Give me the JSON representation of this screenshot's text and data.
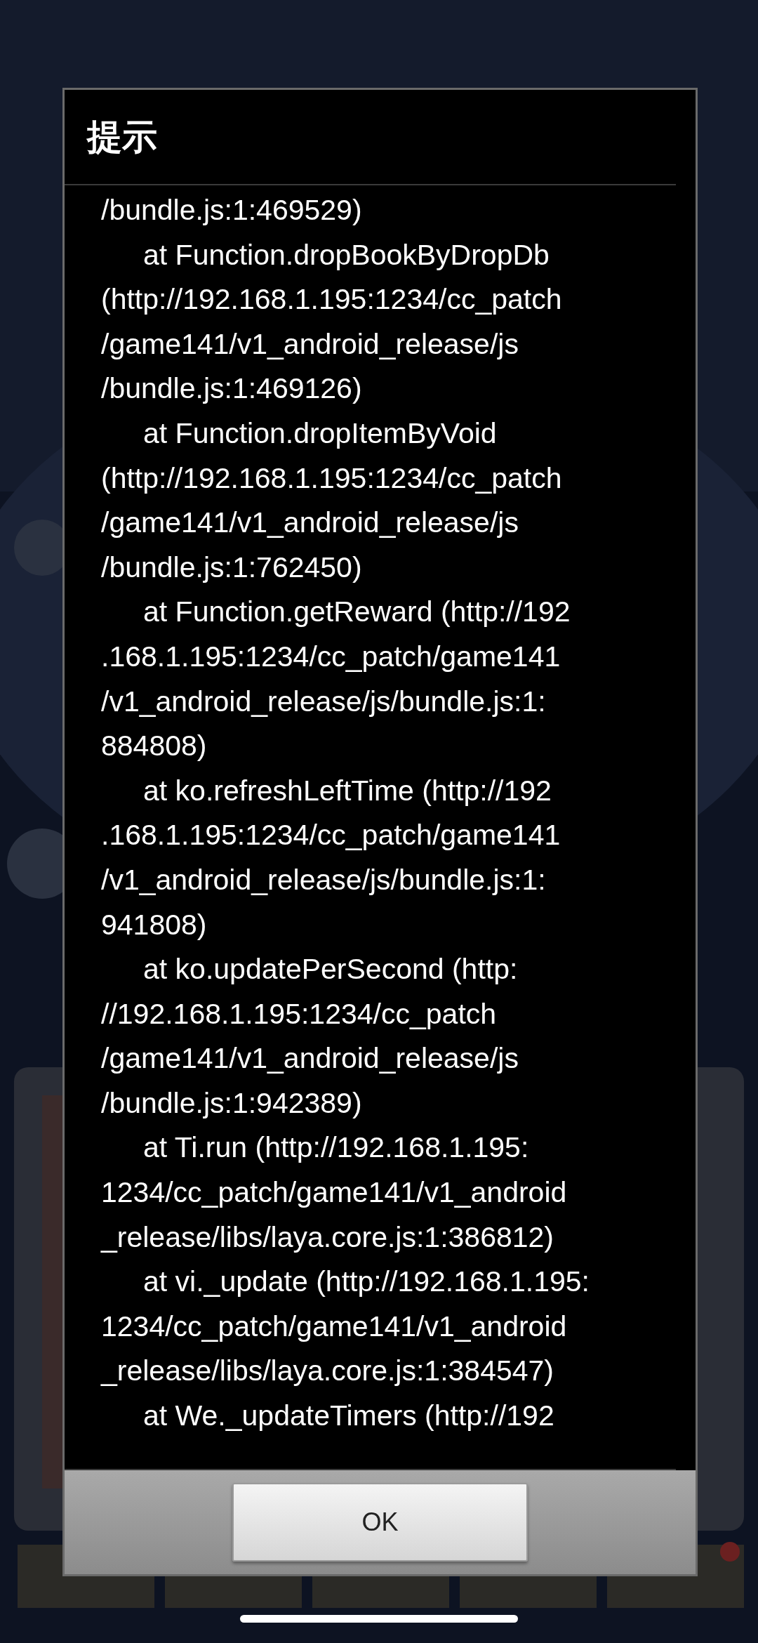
{
  "dialog": {
    "title": "提示",
    "lines": [
      {
        "text": "/bundle.js:1:469529)",
        "indent": false
      },
      {
        "text": "at Function.dropBookByDropDb",
        "indent": true
      },
      {
        "text": "(http://192.168.1.195:1234/cc_patch",
        "indent": false
      },
      {
        "text": "/game141/v1_android_release/js",
        "indent": false
      },
      {
        "text": "/bundle.js:1:469126)",
        "indent": false
      },
      {
        "text": "at Function.dropItemByVoid",
        "indent": true
      },
      {
        "text": "(http://192.168.1.195:1234/cc_patch",
        "indent": false
      },
      {
        "text": "/game141/v1_android_release/js",
        "indent": false
      },
      {
        "text": "/bundle.js:1:762450)",
        "indent": false
      },
      {
        "text": "at Function.getReward (http://192",
        "indent": true
      },
      {
        "text": ".168.1.195:1234/cc_patch/game141",
        "indent": false
      },
      {
        "text": "/v1_android_release/js/bundle.js:1:",
        "indent": false
      },
      {
        "text": "884808)",
        "indent": false
      },
      {
        "text": "at ko.refreshLeftTime (http://192",
        "indent": true
      },
      {
        "text": ".168.1.195:1234/cc_patch/game141",
        "indent": false
      },
      {
        "text": "/v1_android_release/js/bundle.js:1:",
        "indent": false
      },
      {
        "text": "941808)",
        "indent": false
      },
      {
        "text": "at ko.updatePerSecond (http:",
        "indent": true
      },
      {
        "text": "//192.168.1.195:1234/cc_patch",
        "indent": false
      },
      {
        "text": "/game141/v1_android_release/js",
        "indent": false
      },
      {
        "text": "/bundle.js:1:942389)",
        "indent": false
      },
      {
        "text": "at Ti.run (http://192.168.1.195:",
        "indent": true
      },
      {
        "text": "1234/cc_patch/game141/v1_android",
        "indent": false
      },
      {
        "text": "_release/libs/laya.core.js:1:386812)",
        "indent": false
      },
      {
        "text": "at vi._update (http://192.168.1.195:",
        "indent": true
      },
      {
        "text": "1234/cc_patch/game141/v1_android",
        "indent": false
      },
      {
        "text": "_release/libs/laya.core.js:1:384547)",
        "indent": false
      },
      {
        "text": "at We._updateTimers (http://192",
        "indent": true
      }
    ],
    "button": "OK"
  }
}
